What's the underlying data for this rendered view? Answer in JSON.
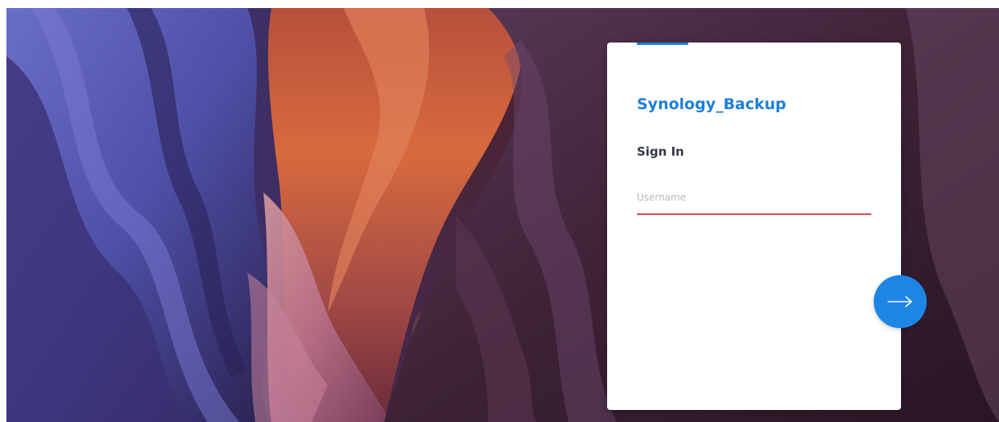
{
  "login": {
    "server_name": "Synology_Backup",
    "title": "Sign In",
    "username": {
      "value": "",
      "placeholder": "Username"
    },
    "next_button": {
      "icon": "arrow-right-icon"
    }
  },
  "colors": {
    "accent": "#1d7fd9",
    "button": "#1d85e6",
    "field_underline_error": "#e0494e",
    "card_background": "#ffffff",
    "title_text": "#333a44"
  },
  "background": {
    "icon": "canyon-wallpaper"
  }
}
